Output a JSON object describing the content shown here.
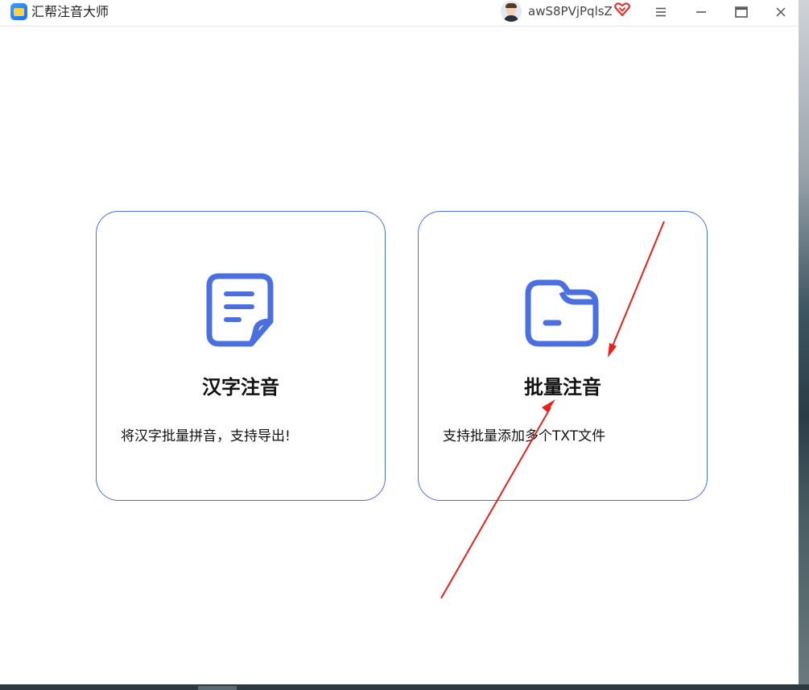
{
  "app": {
    "title": "汇帮注音大师"
  },
  "user": {
    "name": "awS8PVjPqlsZ"
  },
  "window_controls": {
    "menu_icon": "menu-icon",
    "minimize_icon": "minimize-icon",
    "maximize_icon": "maximize-icon",
    "close_icon": "close-icon"
  },
  "cards": [
    {
      "icon": "document-icon",
      "title": "汉字注音",
      "description": "将汉字批量拼音，支持导出!"
    },
    {
      "icon": "folder-icon",
      "title": "批量注音",
      "description": "支持批量添加多个TXT文件"
    }
  ],
  "colors": {
    "accent": "#4a6fe0",
    "annotation": "#e8221b"
  }
}
